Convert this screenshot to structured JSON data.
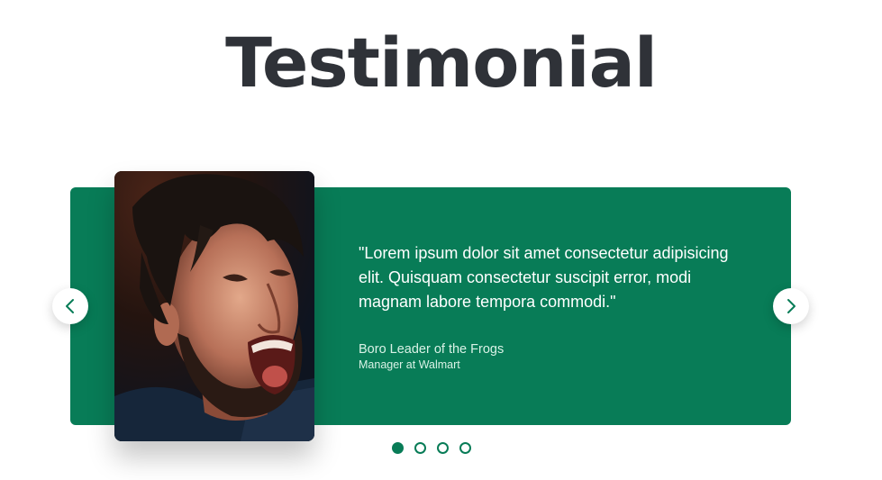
{
  "page": {
    "title": "Testimonial"
  },
  "testimonial": {
    "quote": "\"Lorem ipsum dolor sit amet consectetur adipisicing elit. Quisquam consectetur suscipit error, modi magnam labore tempora commodi.\"",
    "author_name": "Boro Leader of the Frogs",
    "author_role": "Manager at Walmart"
  },
  "carousel": {
    "prev_icon": "chevron-left-icon",
    "next_icon": "chevron-right-icon",
    "slide_count": 4,
    "active_index": 0
  },
  "colors": {
    "accent": "#087c57",
    "title": "#2f3238",
    "background": "#ffffff"
  }
}
